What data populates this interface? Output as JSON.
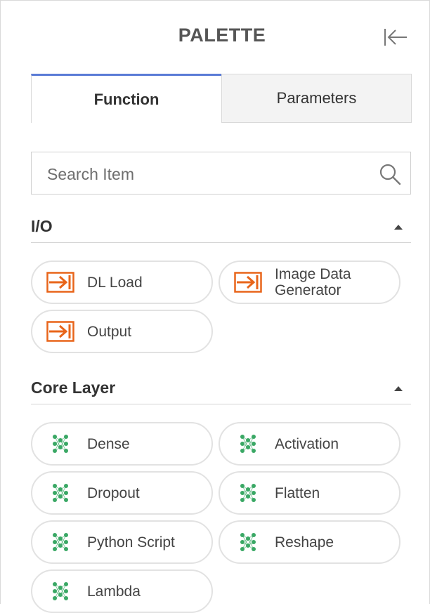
{
  "header": {
    "title": "PALETTE",
    "collapse_icon": "collapse-left-icon"
  },
  "tabs": [
    {
      "label": "Function",
      "active": true
    },
    {
      "label": "Parameters",
      "active": false
    }
  ],
  "search": {
    "placeholder": "Search Item",
    "value": "",
    "icon": "search-icon"
  },
  "sections": [
    {
      "title": "I/O",
      "expanded": true,
      "items": [
        {
          "label": "DL Load",
          "icon": "io-arrow-icon"
        },
        {
          "label": "Image Data\nGenerator",
          "icon": "io-arrow-icon"
        },
        {
          "label": "Output",
          "icon": "io-arrow-icon"
        }
      ]
    },
    {
      "title": "Core Layer",
      "expanded": true,
      "items": [
        {
          "label": "Dense",
          "icon": "network-icon"
        },
        {
          "label": "Activation",
          "icon": "network-icon"
        },
        {
          "label": "Dropout",
          "icon": "network-icon"
        },
        {
          "label": "Flatten",
          "icon": "network-icon"
        },
        {
          "label": "Python Script",
          "icon": "network-icon"
        },
        {
          "label": "Reshape",
          "icon": "network-icon"
        },
        {
          "label": "Lambda",
          "icon": "network-icon"
        }
      ]
    }
  ],
  "colors": {
    "tab_accent": "#5a7bd6",
    "io_icon": "#e8651a",
    "layer_icon": "#3aa865"
  }
}
